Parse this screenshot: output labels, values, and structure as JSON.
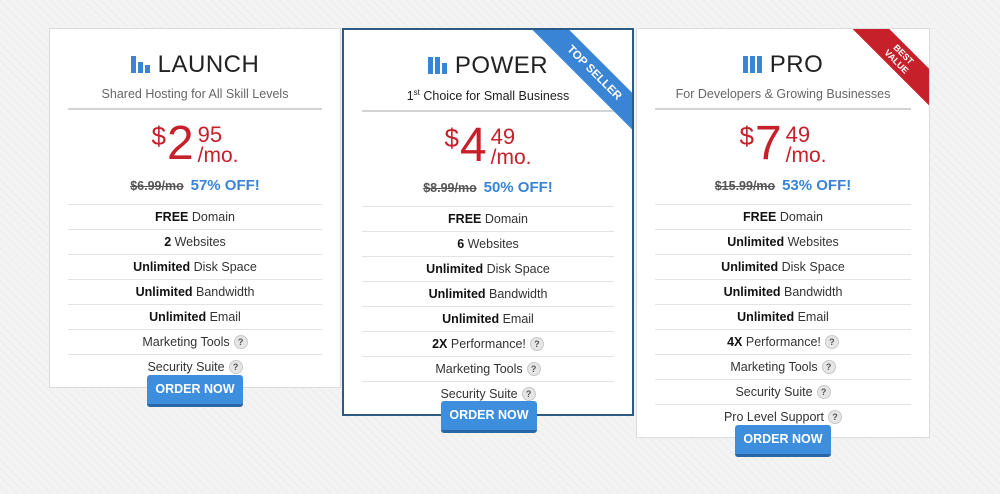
{
  "plans": [
    {
      "name": "LAUNCH",
      "subtitle": "Shared Hosting for All Skill Levels",
      "currency": "$",
      "dollars": "2",
      "cents": "95",
      "per": "/mo.",
      "old_price": "$6.99/mo",
      "discount": "57% OFF!",
      "features": [
        {
          "bold": "FREE",
          "text": " Domain"
        },
        {
          "bold": "2",
          "text": " Websites"
        },
        {
          "bold": "Unlimited",
          "text": " Disk Space"
        },
        {
          "bold": "Unlimited",
          "text": " Bandwidth"
        },
        {
          "bold": "Unlimited",
          "text": " Email"
        },
        {
          "bold": "",
          "text": "Marketing Tools"
        },
        {
          "bold": "",
          "text": "Security Suite"
        }
      ],
      "order_label": "ORDER NOW"
    },
    {
      "name": "POWER",
      "subtitle_sup": "st",
      "subtitle_num": "1",
      "subtitle": " Choice for Small Business",
      "currency": "$",
      "dollars": "4",
      "cents": "49",
      "per": "/mo.",
      "old_price": "$8.99/mo",
      "discount": "50% OFF!",
      "ribbon": "TOP SELLER",
      "features": [
        {
          "bold": "FREE",
          "text": " Domain"
        },
        {
          "bold": "6",
          "text": " Websites"
        },
        {
          "bold": "Unlimited",
          "text": " Disk Space"
        },
        {
          "bold": "Unlimited",
          "text": " Bandwidth"
        },
        {
          "bold": "Unlimited",
          "text": " Email"
        },
        {
          "bold": "2X",
          "text": " Performance!"
        },
        {
          "bold": "",
          "text": "Marketing Tools"
        },
        {
          "bold": "",
          "text": "Security Suite"
        }
      ],
      "order_label": "ORDER NOW"
    },
    {
      "name": "PRO",
      "subtitle": "For Developers & Growing Businesses",
      "currency": "$",
      "dollars": "7",
      "cents": "49",
      "per": "/mo.",
      "old_price": "$15.99/mo",
      "discount": "53% OFF!",
      "ribbon_line1": "BEST",
      "ribbon_line2": "VALUE",
      "features": [
        {
          "bold": "FREE",
          "text": " Domain"
        },
        {
          "bold": "Unlimited",
          "text": " Websites"
        },
        {
          "bold": "Unlimited",
          "text": " Disk Space"
        },
        {
          "bold": "Unlimited",
          "text": " Bandwidth"
        },
        {
          "bold": "Unlimited",
          "text": " Email"
        },
        {
          "bold": "4X",
          "text": " Performance!"
        },
        {
          "bold": "",
          "text": "Marketing Tools"
        },
        {
          "bold": "",
          "text": "Security Suite"
        },
        {
          "bold": "",
          "text": "Pro Level Support"
        }
      ],
      "order_label": "ORDER NOW"
    }
  ],
  "help_glyph": "?",
  "colors": {
    "accent": "#3a84d6",
    "price": "#c6202b",
    "power_border": "#2e5a86"
  }
}
